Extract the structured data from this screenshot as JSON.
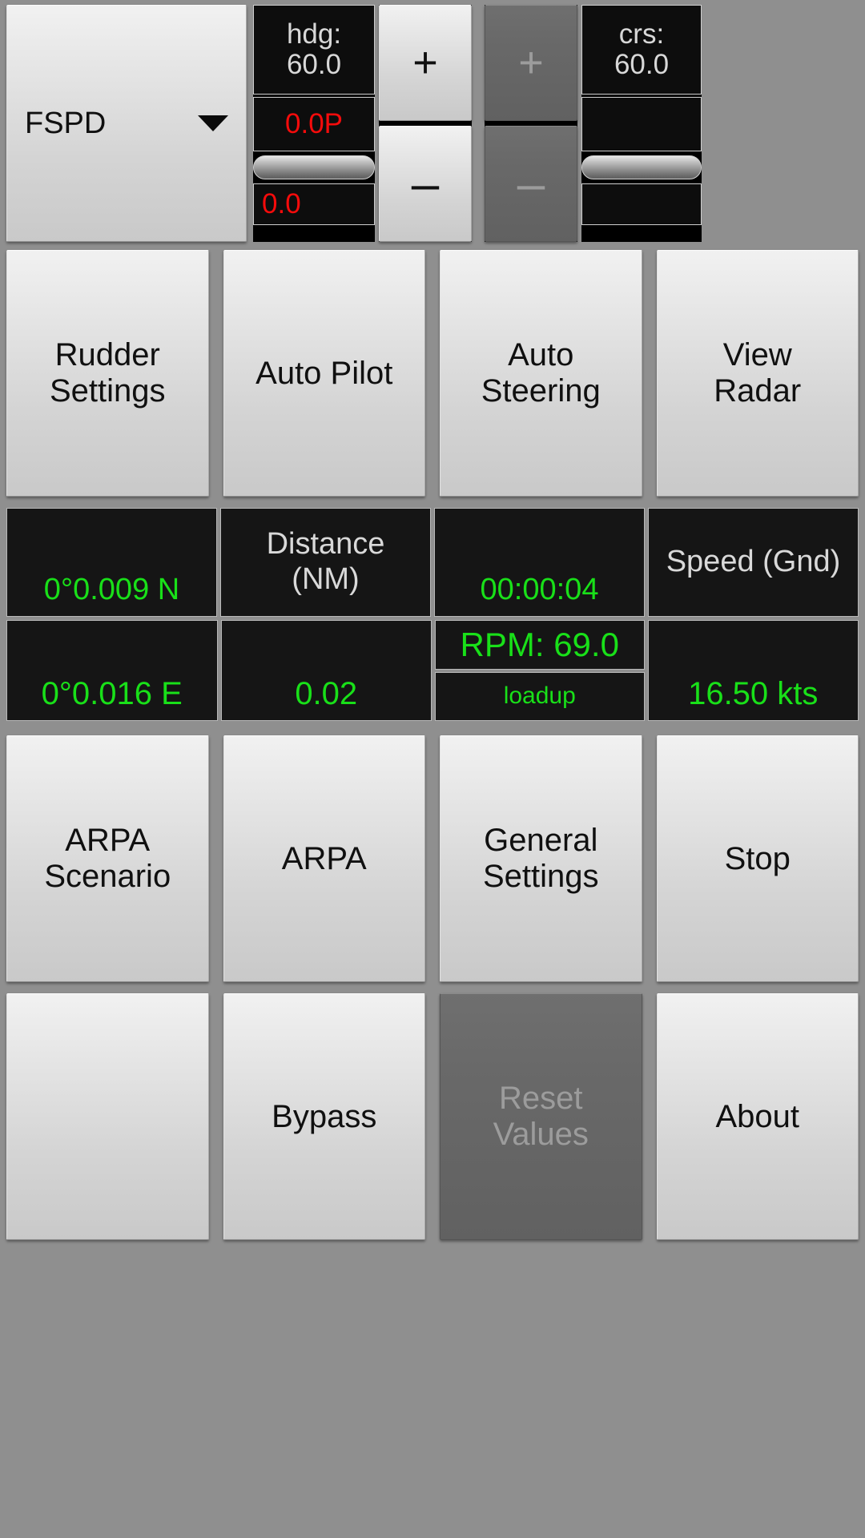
{
  "header": {
    "speed_mode": {
      "label": "FSPD",
      "icon": "chevron-down-icon"
    },
    "heading": {
      "title": "hdg:\n60.0",
      "title_line1": "hdg:",
      "title_line2": "60.0",
      "rudder_order": "0.0P",
      "rudder_actual": "0.0",
      "slider": "heading-seekbar"
    },
    "heading_stepper": {
      "plus": "+",
      "minus": "–",
      "enabled": true
    },
    "course_stepper": {
      "plus": "+",
      "minus": "–",
      "enabled": false
    },
    "course": {
      "title_line1": "crs:",
      "title_line2": "60.0",
      "value2": "",
      "value3": "",
      "slider": "course-seekbar"
    }
  },
  "nav_row": {
    "buttons": [
      {
        "label": "Rudder\nSettings",
        "line1": "Rudder",
        "line2": "Settings",
        "enabled": true
      },
      {
        "label": "Auto Pilot",
        "line1": "Auto Pilot",
        "line2": "",
        "enabled": true
      },
      {
        "label": "Auto\nSteering",
        "line1": "Auto",
        "line2": "Steering",
        "enabled": true
      },
      {
        "label": "View\nRadar",
        "line1": "View",
        "line2": "Radar",
        "enabled": true
      }
    ]
  },
  "data_row_1": {
    "cells": [
      {
        "text": "0°0.009 N",
        "color": "green",
        "name": "latitude-readout"
      },
      {
        "text": "Distance\n(NM)",
        "line1": "Distance",
        "line2": "(NM)",
        "color": "white",
        "name": "distance-label"
      },
      {
        "text": "00:00:04",
        "color": "green",
        "name": "elapsed-time-readout"
      },
      {
        "text": "Speed (Gnd)",
        "color": "white",
        "name": "speed-ground-label"
      }
    ]
  },
  "data_row_2": {
    "cells": [
      {
        "text": "0°0.016 E",
        "color": "green",
        "name": "longitude-readout"
      },
      {
        "text": "0.02",
        "color": "green",
        "name": "distance-readout"
      },
      {
        "text": "16.50 kts",
        "color": "green",
        "name": "speed-ground-readout"
      }
    ],
    "engine": {
      "rpm": "RPM: 69.0",
      "state": "loadup",
      "color": "green"
    }
  },
  "action_row": {
    "buttons": [
      {
        "label": "ARPA\nScenario",
        "line1": "ARPA",
        "line2": "Scenario",
        "enabled": true
      },
      {
        "label": "ARPA",
        "line1": "ARPA",
        "line2": "",
        "enabled": true
      },
      {
        "label": "General\nSettings",
        "line1": "General",
        "line2": "Settings",
        "enabled": true
      },
      {
        "label": "Stop",
        "line1": "Stop",
        "line2": "",
        "enabled": true
      }
    ]
  },
  "footer_row": {
    "buttons": [
      {
        "label": "",
        "line1": "",
        "line2": "",
        "enabled": true
      },
      {
        "label": "Bypass",
        "line1": "Bypass",
        "line2": "",
        "enabled": true
      },
      {
        "label": "Reset\nValues",
        "line1": "Reset",
        "line2": "Values",
        "enabled": false
      },
      {
        "label": "About",
        "line1": "About",
        "line2": "",
        "enabled": true
      }
    ]
  },
  "colors": {
    "green": "#19e019",
    "red": "#f50b0b",
    "panel_bg": "#0d0d0d",
    "app_bg": "#8f8f8f",
    "button_face": "#d4d4d4",
    "button_disabled": "#696969"
  }
}
